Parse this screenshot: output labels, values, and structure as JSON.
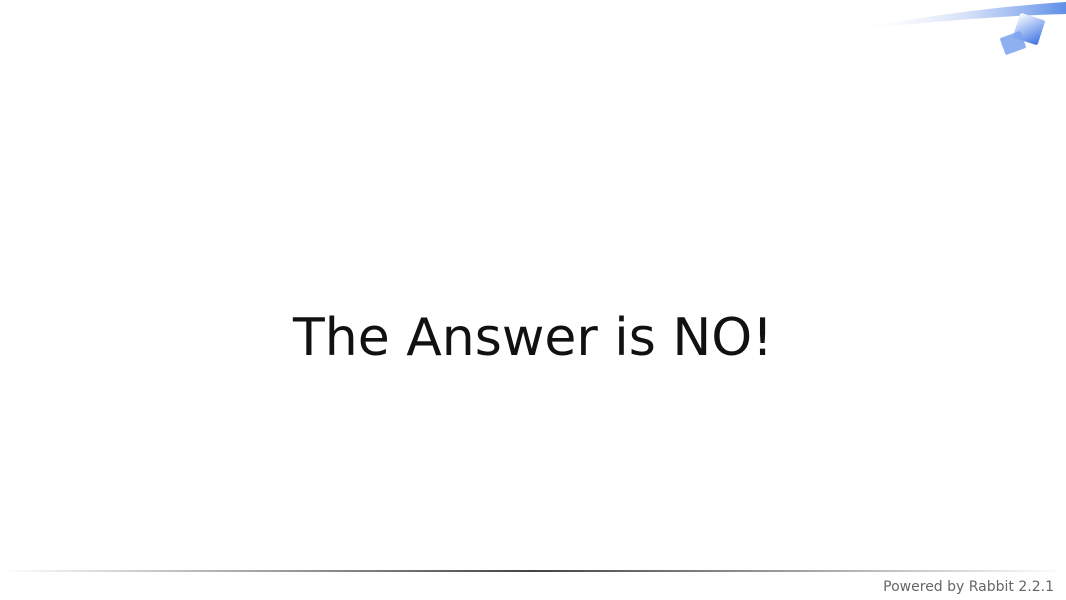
{
  "slide": {
    "title": "The Answer is NO!",
    "footer": "Powered by Rabbit 2.2.1",
    "colors": {
      "background": "#ffffff",
      "title": "#111111",
      "footer_text": "#666666",
      "accent_blue": "#4d7fe6"
    },
    "icons": [
      "swoosh-icon",
      "diamond-icon"
    ]
  }
}
